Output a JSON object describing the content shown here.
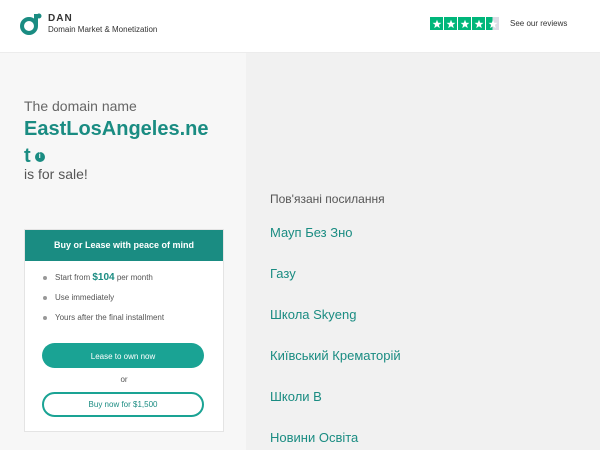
{
  "header": {
    "brand_name": "DAN",
    "brand_tagline": "Domain Market & Monetization",
    "trustpilot_rating_stars": 4.5,
    "reviews_link": "See our reviews"
  },
  "hero": {
    "intro": "The domain name",
    "domain_line1": "EastLosAngeles.ne",
    "domain_line2": "t",
    "for_sale": "is for sale!"
  },
  "card": {
    "title": "Buy or Lease with peace of mind",
    "bullet1_prefix": "Start from",
    "bullet1_price": "$104",
    "bullet1_suffix": "per month",
    "bullet2": "Use immediately",
    "bullet3": "Yours after the final installment",
    "lease_button": "Lease to own now",
    "or": "or",
    "buy_button": "Buy now for $1,500"
  },
  "related": {
    "title": "Пов'язані посилання",
    "links": [
      "Мауп Без Зно",
      "Газу",
      "Школа Skyeng",
      "Київський Крематорій",
      "Школи В",
      "Новини Освіта"
    ]
  },
  "colors": {
    "accent": "#1a8c82",
    "button": "#1aa394",
    "trustpilot_green": "#00b67a"
  }
}
